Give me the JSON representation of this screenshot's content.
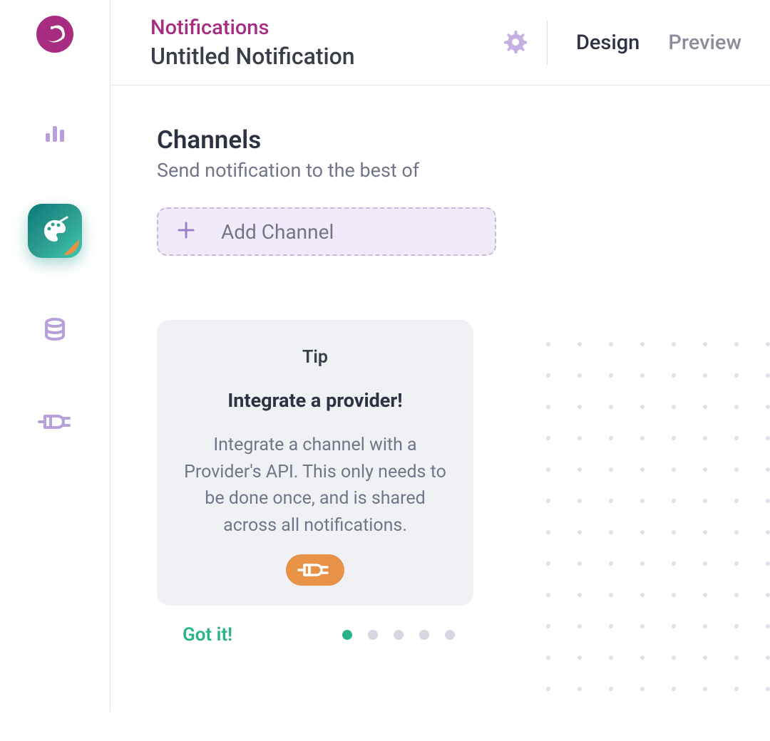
{
  "header": {
    "breadcrumb": "Notifications",
    "title": "Untitled Notification"
  },
  "tabs": {
    "design": "Design",
    "preview": "Preview"
  },
  "section": {
    "title": "Channels",
    "subtitle": "Send notification to the best of"
  },
  "addChannel": {
    "label": "Add Channel"
  },
  "tip": {
    "label": "Tip",
    "title": "Integrate a provider!",
    "body": "Integrate a channel with a Provider's API. This only needs to be done once, and is shared across all notifications.",
    "dismiss": "Got it!"
  }
}
